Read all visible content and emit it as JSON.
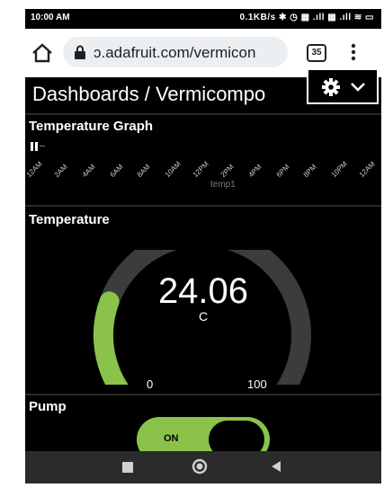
{
  "status_bar": {
    "time": "10:00 AM",
    "right_text": "0.1KB/s ✱ ◷ ▦ .ıll ▦ .ıll ≋ ▭"
  },
  "browser": {
    "url": "ɔ.adafruit.com/vermicon",
    "tab_count": "35",
    "icons": [
      "home-icon",
      "lock-icon",
      "menu-kebab-icon"
    ]
  },
  "dashboard": {
    "title": "Dashboards / Vermicompo",
    "settings_icons": [
      "gear-icon",
      "chevron-down-icon"
    ]
  },
  "temperature_graph": {
    "title": "Temperature Graph",
    "x_ticks": [
      "12AM",
      "2AM",
      "4AM",
      "6AM",
      "8AM",
      "10AM",
      "12PM",
      "2PM",
      "4PM",
      "6PM",
      "8PM",
      "10PM",
      "12AM"
    ],
    "legend": "temp1"
  },
  "gauge": {
    "title": "Temperature",
    "value": "24.06",
    "unit": "C",
    "min": "0",
    "max": "100",
    "fraction": 0.2406,
    "fill_color": "#8bc34a",
    "track_color": "#3c3c3c"
  },
  "pump": {
    "title": "Pump",
    "state": "ON",
    "on_color": "#8bc34a"
  },
  "navbar": {
    "icons": [
      "recents-square-icon",
      "home-circle-icon",
      "back-triangle-icon"
    ]
  }
}
